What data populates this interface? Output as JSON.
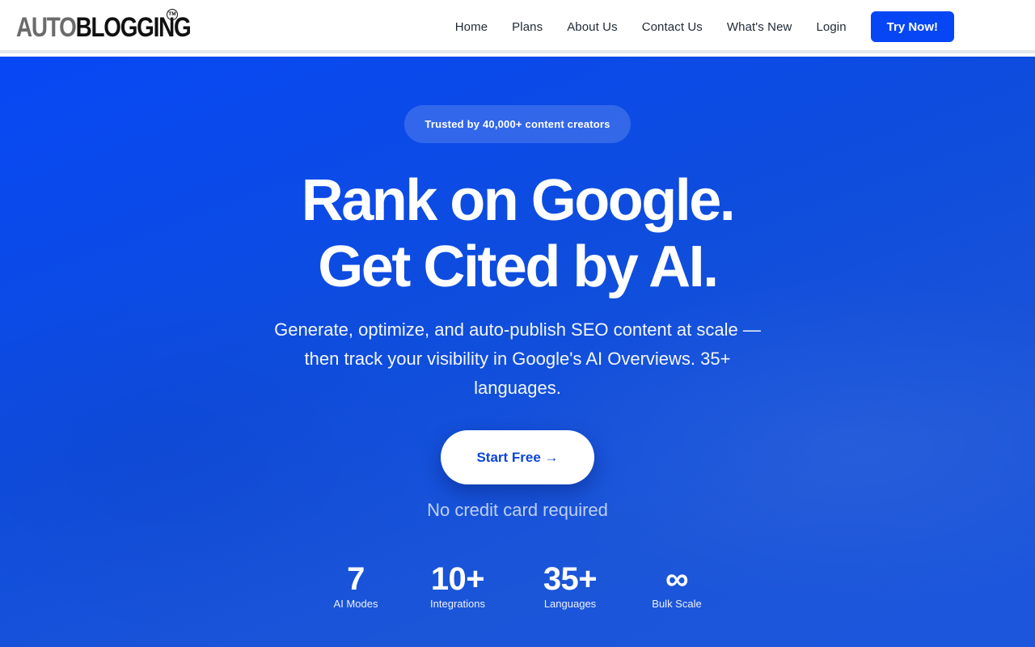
{
  "header": {
    "logo": {
      "part1": "AUTO",
      "part2": "BLOGGING",
      "trademark": "TM"
    },
    "nav": [
      "Home",
      "Plans",
      "About Us",
      "Contact Us",
      "What's New",
      "Login"
    ],
    "cta_label": "Try Now!"
  },
  "hero": {
    "badge": "Trusted by 40,000+ content creators",
    "headline_line1": "Rank on Google.",
    "headline_line2": "Get Cited by AI.",
    "subtext": "Generate, optimize, and auto-publish SEO content at scale — then track your visibility in Google's AI Overviews. 35+ languages.",
    "start_button": "Start Free →",
    "note": "No credit card required",
    "stats": [
      {
        "value": "7",
        "label": "AI Modes"
      },
      {
        "value": "10+",
        "label": "Integrations"
      },
      {
        "value": "35+",
        "label": "Languages"
      },
      {
        "value": "∞",
        "label": "Bulk Scale"
      }
    ]
  },
  "colors": {
    "brand_blue": "#0646f4",
    "hero_gradient_start": "#0748f5",
    "hero_gradient_end": "#1c56dd",
    "button_text_blue": "#0b45d9"
  }
}
